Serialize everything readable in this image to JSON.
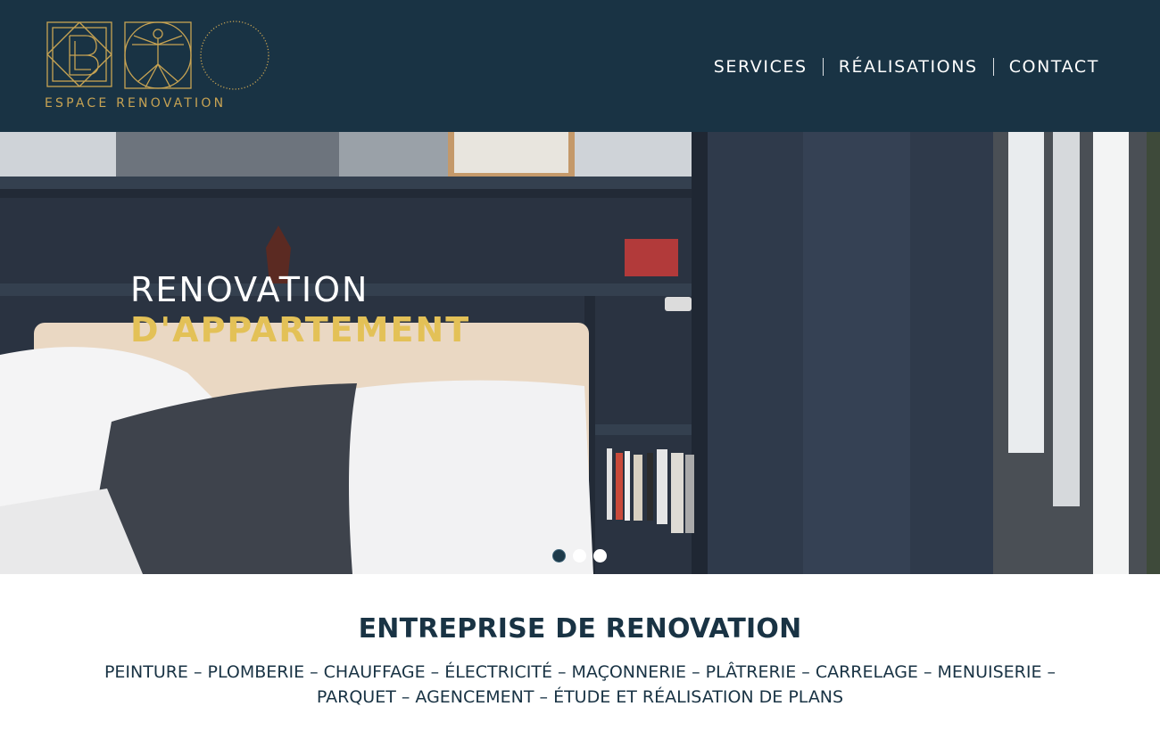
{
  "brand": {
    "name": "ESPACE RENOVATION",
    "accent_color": "#c7a353",
    "header_bg": "#193344"
  },
  "nav": {
    "items": [
      {
        "label": "SERVICES"
      },
      {
        "label": "RÉALISATIONS"
      },
      {
        "label": "CONTACT"
      }
    ]
  },
  "hero": {
    "line1": "RENOVATION",
    "line2": "D'APPARTEMENT",
    "highlight_color": "#e3c157",
    "slider": {
      "total": 3,
      "active": 1
    }
  },
  "intro": {
    "title": "ENTREPRISE DE RENOVATION",
    "services_line1": "PEINTURE – PLOMBERIE – CHAUFFAGE – ÉLECTRICITÉ – MAÇONNERIE – PLÂTRERIE – CARRELAGE – MENUISERIE –",
    "services_line2": "PARQUET – AGENCEMENT – ÉTUDE ET RÉALISATION DE PLANS"
  }
}
